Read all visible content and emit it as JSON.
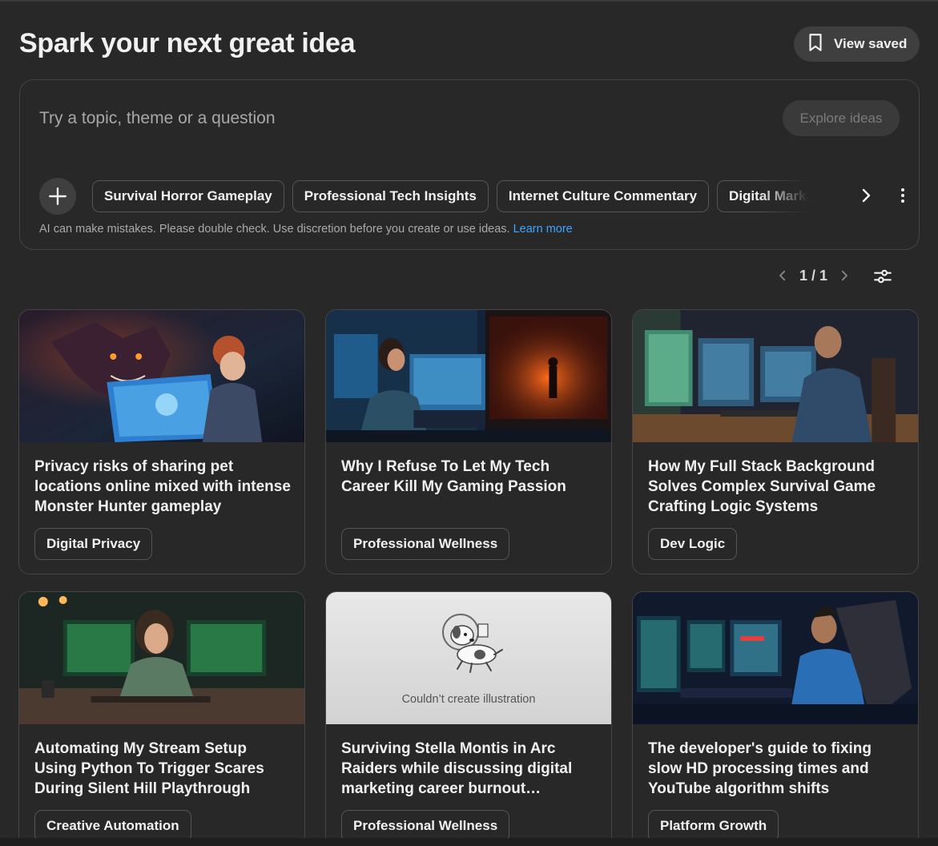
{
  "header": {
    "title": "Spark your next great idea",
    "view_saved_label": "View saved"
  },
  "prompt": {
    "placeholder": "Try a topic, theme or a question",
    "explore_label": "Explore ideas",
    "chips": [
      "Survival Horror Gameplay",
      "Professional Tech Insights",
      "Internet Culture Commentary",
      "Digital Marketing"
    ],
    "disclaimer": "AI can make mistakes. Please double check. Use discretion before you create or use ideas.",
    "learn_more": "Learn more"
  },
  "pager": {
    "text": "1 / 1"
  },
  "cards": [
    {
      "title": "Privacy risks of sharing pet locations online mixed with intense Monster Hunter gameplay",
      "tag": "Digital Privacy"
    },
    {
      "title": "Why I Refuse To Let My Tech Career Kill My Gaming Passion",
      "tag": "Professional Wellness"
    },
    {
      "title": "How My Full Stack Background Solves Complex Survival Game Crafting Logic Systems",
      "tag": "Dev Logic"
    },
    {
      "title": "Automating My Stream Setup Using Python To Trigger Scares During Silent Hill Playthrough",
      "tag": "Creative Automation"
    },
    {
      "title": "Surviving Stella Montis in Arc Raiders while discussing digital marketing career burnout…",
      "tag": "Professional Wellness",
      "illustration_status": "Couldn’t create illustration"
    },
    {
      "title": "The developer's guide to fixing slow HD processing times and YouTube algorithm shifts",
      "tag": "Platform Growth"
    }
  ],
  "colors": {
    "background": "#282828",
    "surface": "#3f3f3f",
    "border": "#454545",
    "link": "#3ea6ff",
    "text": "#f1f1f1"
  },
  "icons": [
    "bookmark-icon",
    "plus-icon",
    "chevron-right-icon",
    "more-vert-icon",
    "chevron-left-icon",
    "tune-icon"
  ]
}
